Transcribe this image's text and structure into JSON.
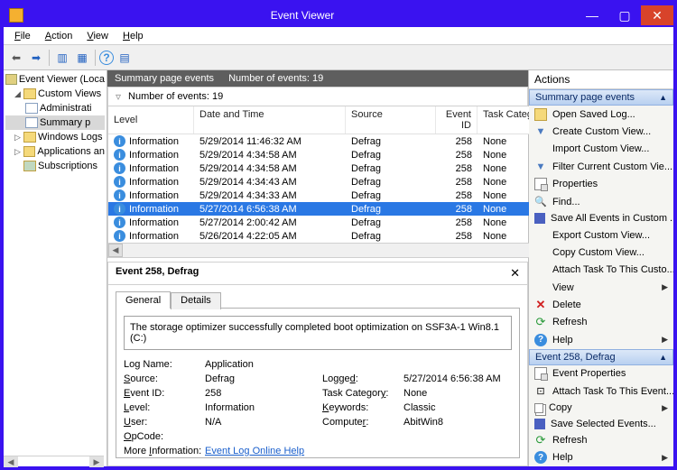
{
  "titlebar": {
    "title": "Event Viewer"
  },
  "menubar": [
    "File",
    "Action",
    "View",
    "Help"
  ],
  "tree": {
    "root": "Event Viewer (Loca",
    "custom_views": "Custom Views",
    "admin": "Administrati",
    "summary": "Summary p",
    "windows_logs": "Windows Logs",
    "apps": "Applications an",
    "subs": "Subscriptions"
  },
  "center": {
    "header_title": "Summary page events",
    "header_count": "Number of events: 19",
    "filter_count": "Number of events: 19",
    "columns": {
      "level": "Level",
      "date": "Date and Time",
      "source": "Source",
      "eid": "Event ID",
      "task": "Task Category"
    },
    "rows": [
      {
        "level": "Information",
        "date": "5/29/2014 11:46:32 AM",
        "source": "Defrag",
        "eid": "258",
        "task": "None"
      },
      {
        "level": "Information",
        "date": "5/29/2014 4:34:58 AM",
        "source": "Defrag",
        "eid": "258",
        "task": "None"
      },
      {
        "level": "Information",
        "date": "5/29/2014 4:34:58 AM",
        "source": "Defrag",
        "eid": "258",
        "task": "None"
      },
      {
        "level": "Information",
        "date": "5/29/2014 4:34:43 AM",
        "source": "Defrag",
        "eid": "258",
        "task": "None"
      },
      {
        "level": "Information",
        "date": "5/29/2014 4:34:33 AM",
        "source": "Defrag",
        "eid": "258",
        "task": "None"
      },
      {
        "level": "Information",
        "date": "5/27/2014 6:56:38 AM",
        "source": "Defrag",
        "eid": "258",
        "task": "None",
        "selected": true
      },
      {
        "level": "Information",
        "date": "5/27/2014 2:00:42 AM",
        "source": "Defrag",
        "eid": "258",
        "task": "None"
      },
      {
        "level": "Information",
        "date": "5/26/2014 4:22:05 AM",
        "source": "Defrag",
        "eid": "258",
        "task": "None"
      }
    ]
  },
  "detail": {
    "title": "Event 258, Defrag",
    "tabs": {
      "general": "General",
      "details": "Details"
    },
    "message": "The storage optimizer successfully completed boot optimization on SSF3A-1 Win8.1 (C:)",
    "fields": {
      "log_name_lbl": "Log Name:",
      "log_name": "Application",
      "source_lbl": "Source:",
      "source": "Defrag",
      "logged_lbl": "Logged:",
      "logged": "5/27/2014 6:56:38 AM",
      "event_id_lbl": "Event ID:",
      "event_id": "258",
      "task_cat_lbl": "Task Category:",
      "task_cat": "None",
      "level_lbl": "Level:",
      "level": "Information",
      "keywords_lbl": "Keywords:",
      "keywords": "Classic",
      "user_lbl": "User:",
      "user": "N/A",
      "computer_lbl": "Computer:",
      "computer": "AbitWin8",
      "opcode_lbl": "OpCode:",
      "more_info_lbl": "More Information:",
      "more_info_link": "Event Log Online Help"
    }
  },
  "actions": {
    "title": "Actions",
    "section1": "Summary page events",
    "section2": "Event 258, Defrag",
    "s1": {
      "open_saved_log": "Open Saved Log...",
      "create_custom_view": "Create Custom View...",
      "import_custom_view": "Import Custom View...",
      "filter_current": "Filter Current Custom Vie...",
      "properties": "Properties",
      "find": "Find...",
      "save_all": "Save All Events in Custom ...",
      "export_custom": "Export Custom View...",
      "copy_custom": "Copy Custom View...",
      "attach_task": "Attach Task To This Custo...",
      "view": "View",
      "delete": "Delete",
      "refresh": "Refresh",
      "help": "Help"
    },
    "s2": {
      "event_properties": "Event Properties",
      "attach_task_event": "Attach Task To This Event...",
      "copy": "Copy",
      "save_selected": "Save Selected Events...",
      "refresh": "Refresh",
      "help": "Help"
    }
  }
}
